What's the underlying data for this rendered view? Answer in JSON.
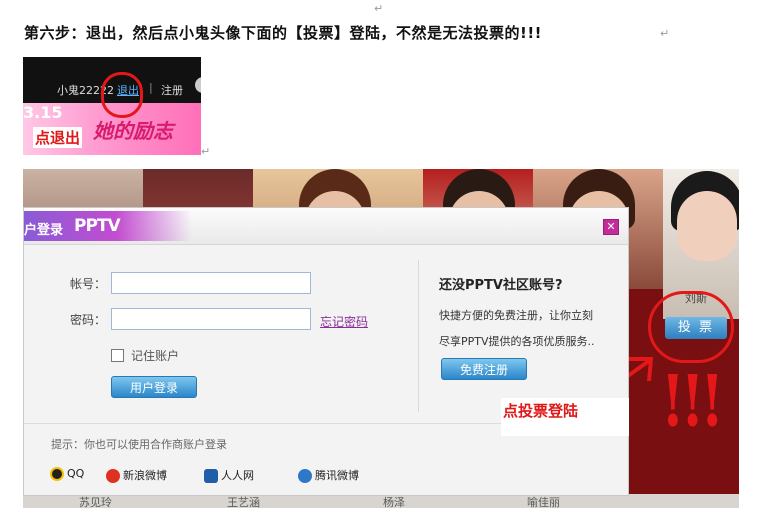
{
  "step_heading": "第六步：退出，然后点小鬼头像下面的【投票】登陆，不然是无法投票的!!!",
  "paragraph_mark": "↵",
  "top_screenshot": {
    "username": "小鬼22222",
    "logout_link": "退出",
    "separator": "|",
    "register_link": "注册",
    "banner_number": "3.15",
    "banner_slogan": "她的励志",
    "annotation": "点退出"
  },
  "main_screenshot": {
    "candidate_name": "刘斯",
    "vote_button": "投 票",
    "exclamations": "!!!",
    "bottom_names": [
      "苏见玲",
      "王艺涵",
      "杨泽",
      "喻佳丽"
    ]
  },
  "login_dialog": {
    "title": "户登录",
    "logo_text": "PPTV",
    "close_icon": "close-icon",
    "account_label": "帐号：",
    "account_value": "",
    "password_label": "密码：",
    "password_value": "",
    "forgot_password": "忘记密码",
    "remember_label": "记住账户",
    "login_button": "用户登录",
    "register_heading": "还没PPTV社区账号?",
    "register_line1": "快捷方便的免费注册，让你立刻",
    "register_line2": "尽享PPTV提供的各项优质服务..",
    "register_button": "免费注册",
    "partner_hint": "提示：你也可以使用合作商账户登录",
    "partners": [
      {
        "name": "QQ",
        "icon": "qq-penguin-icon",
        "color": "#e03020"
      },
      {
        "name": "新浪微博",
        "icon": "weibo-icon",
        "color": "#e03020"
      },
      {
        "name": "人人网",
        "icon": "renren-icon",
        "color": "#1f5ea8"
      },
      {
        "name": "腾讯微博",
        "icon": "tencent-weibo-icon",
        "color": "#2d78c7"
      }
    ]
  },
  "callout_vote": "点投票登陆",
  "colors": {
    "annotation_red": "#e41818",
    "dialog_accent": "#c24dd0",
    "button_blue": "#2b86c9"
  }
}
